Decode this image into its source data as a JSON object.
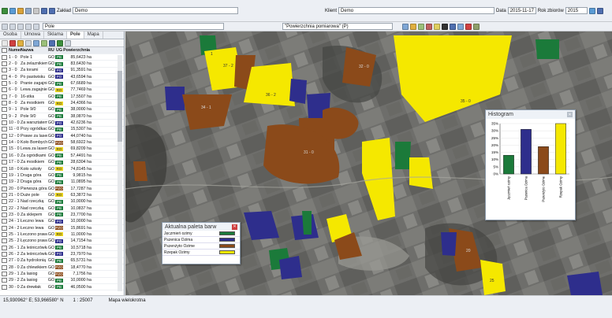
{
  "toolbar1": {
    "zaklad_label": "Zakład",
    "zaklad_value": "Demo",
    "klient_label": "Klient",
    "klient_value": "Demo",
    "date_label": "Data",
    "date_value": "2015-11-17",
    "season_label": "Rok zbiorów",
    "season_value": "2015"
  },
  "toolbar2": {
    "search_value": "Pole",
    "layer_value": "\"Powierzchnia pomiarowa\" (P)"
  },
  "tabs": [
    "Osoba",
    "Umowa",
    "Sklama",
    "Pole",
    "Mapa"
  ],
  "table": {
    "headers": [
      "Numer",
      "Nazwa",
      "RU",
      "UG",
      "Powierzchnia"
    ],
    "rows": [
      [
        "1 - 0",
        "Pole 1",
        "GO",
        "PB",
        "85,6423 ha",
        "#1b7a3a"
      ],
      [
        "2 - 0",
        "Za żelaznikiem",
        "GO",
        "PB",
        "83,6430 ha",
        "#1b7a3a"
      ],
      [
        "3 - 0",
        "Za torami",
        "GO",
        "PO",
        "91,3591 ha",
        "#2e2e8c"
      ],
      [
        "4 - 0",
        "Po pastwisku",
        "GO",
        "PO",
        "43,6594 ha",
        "#2e2e8c"
      ],
      [
        "5 - 0",
        "Pranie zagajnie",
        "GO",
        "PB",
        "67,6689 ha",
        "#1b7a3a"
      ],
      [
        "6 - 0",
        "Lewa zagajnie",
        "GO",
        "RO",
        "77,7469 ha",
        "#e8d21a"
      ],
      [
        "7 - 0",
        "16-stka",
        "GO",
        "PB",
        "17,5507 ha",
        "#1b7a3a"
      ],
      [
        "8 - 0",
        "Za mostkiem",
        "GO",
        "RO",
        "24,4366 ha",
        "#e8d21a"
      ],
      [
        "9 - 1",
        "Pole 9/0",
        "GO",
        "PB",
        "38,0000 ha",
        "#1b7a3a"
      ],
      [
        "9 - 2",
        "Pole 9/0",
        "GO",
        "PB",
        "38,0870 ha",
        "#1b7a3a"
      ],
      [
        "10 - 0",
        "Za warsztatem",
        "GO",
        "PO",
        "42,6236 ha",
        "#2e2e8c"
      ],
      [
        "11 - 0",
        "Przy ogródkach",
        "GO",
        "PB",
        "15,5307 ha",
        "#1b7a3a"
      ],
      [
        "12 - 0",
        "Prawe za lasem",
        "GO",
        "PO",
        "44,0740 ha",
        "#2e2e8c"
      ],
      [
        "14 - 0",
        "Koło Bombych",
        "GO",
        "PZO",
        "58,6922 ha",
        "#8b4a1a"
      ],
      [
        "15 - 0",
        "Lewa za lasem",
        "GO",
        "RO",
        "69,8209 ha",
        "#e8d21a"
      ],
      [
        "16 - 0",
        "Za ogródkami",
        "GO",
        "PB",
        "57,4491 ha",
        "#1b7a3a"
      ],
      [
        "17 - 0",
        "Za mostkiem",
        "GO",
        "PB",
        "28,6304 ha",
        "#1b7a3a"
      ],
      [
        "18 - 0",
        "Koło szkoły",
        "GO",
        "RO",
        "74,8145 ha",
        "#e8d21a"
      ],
      [
        "19 - 1",
        "Druga góra",
        "GO",
        "PB",
        "9,9815 ha",
        "#1b7a3a"
      ],
      [
        "19 - 2",
        "Druga góra",
        "GO",
        "PB",
        "11,0895 ha",
        "#1b7a3a"
      ],
      [
        "20 - 0",
        "Pierwsza góra",
        "GO",
        "PZO",
        "17,7287 ha",
        "#8b4a1a"
      ],
      [
        "21 - 0",
        "Duże pole",
        "GO",
        "RO",
        "63,3872 ha",
        "#e8d21a"
      ],
      [
        "22 - 1",
        "Nad rzeczką",
        "GO",
        "PB",
        "10,0000 ha",
        "#1b7a3a"
      ],
      [
        "22 - 2",
        "Nad rzeczką",
        "GO",
        "PB",
        "10,0837 ha",
        "#1b7a3a"
      ],
      [
        "23 - 0",
        "Za sklepem",
        "GO",
        "PB",
        "23,7700 ha",
        "#1b7a3a"
      ],
      [
        "24 - 1",
        "Łeczno lewa",
        "GO",
        "PO",
        "10,0000 ha",
        "#2e2e8c"
      ],
      [
        "24 - 2",
        "Łeczno lewa",
        "GO",
        "PZO",
        "15,8691 ha",
        "#8b4a1a"
      ],
      [
        "25 - 1",
        "Łeczono prawa",
        "GO",
        "RO",
        "11,0000 ha",
        "#e8d21a"
      ],
      [
        "25 - 2",
        "Łęczono prawa",
        "GO",
        "PO",
        "14,7154 ha",
        "#2e2e8c"
      ],
      [
        "26 - 1",
        "Za leśniczówką",
        "GO",
        "PB",
        "10,5718 ha",
        "#1b7a3a"
      ],
      [
        "26 - 2",
        "Za leśniczówką",
        "GO",
        "PO",
        "23,7970 ha",
        "#2e2e8c"
      ],
      [
        "27 - 0",
        "Za hydrolonią",
        "GO",
        "PB",
        "65,5731 ha",
        "#1b7a3a"
      ],
      [
        "28 - 0",
        "Za chlewikiem",
        "GO",
        "PZO",
        "18,4770 ha",
        "#8b4a1a"
      ],
      [
        "29 - 1",
        "Za lasiog",
        "GO",
        "PZO",
        "7,1756 ha",
        "#8b4a1a"
      ],
      [
        "29 - 2",
        "Za lasiog",
        "GO",
        "PB",
        "10,0000 ha",
        "#1b7a3a"
      ],
      [
        "30 - 0",
        "Za drewłak",
        "GO",
        "PB",
        "46,0500 ha",
        "#1b7a3a"
      ]
    ]
  },
  "legend": {
    "title": "Aktualna paleta barw",
    "items": [
      {
        "name": "Jęczmień ozimy",
        "color": "#1b7a3a"
      },
      {
        "name": "Pszenica Ozima",
        "color": "#2e2e8c"
      },
      {
        "name": "Pszenżyto Ozime",
        "color": "#8b4a1a"
      },
      {
        "name": "Rzepak Ozimy",
        "color": "#f5e800"
      }
    ]
  },
  "histogram": {
    "title": "Histogram"
  },
  "chart_data": {
    "type": "bar",
    "categories": [
      "Jęczmień ozimy",
      "Pszenica Ozima",
      "Pszenżyto Ozime",
      "Rzepak Ozimy"
    ],
    "values": [
      13,
      31,
      19,
      36
    ],
    "colors": [
      "#1b7a3a",
      "#2e2e8c",
      "#8b4a1a",
      "#f5e800"
    ],
    "ylim": [
      0,
      35
    ],
    "yticks": [
      "0%",
      "5%",
      "10%",
      "15%",
      "20%",
      "25%",
      "30%",
      "35%"
    ]
  },
  "map_labels": [
    "1",
    "37 - 2",
    "36 - 2",
    "35 - 0",
    "32 - 0",
    "34 - 1",
    "31 - 0",
    "20",
    "25"
  ],
  "status": {
    "coords": "15,930962° E; 53,966580° N",
    "scale": "1 : 25007",
    "map_type": "Mapa wielokrotna"
  }
}
